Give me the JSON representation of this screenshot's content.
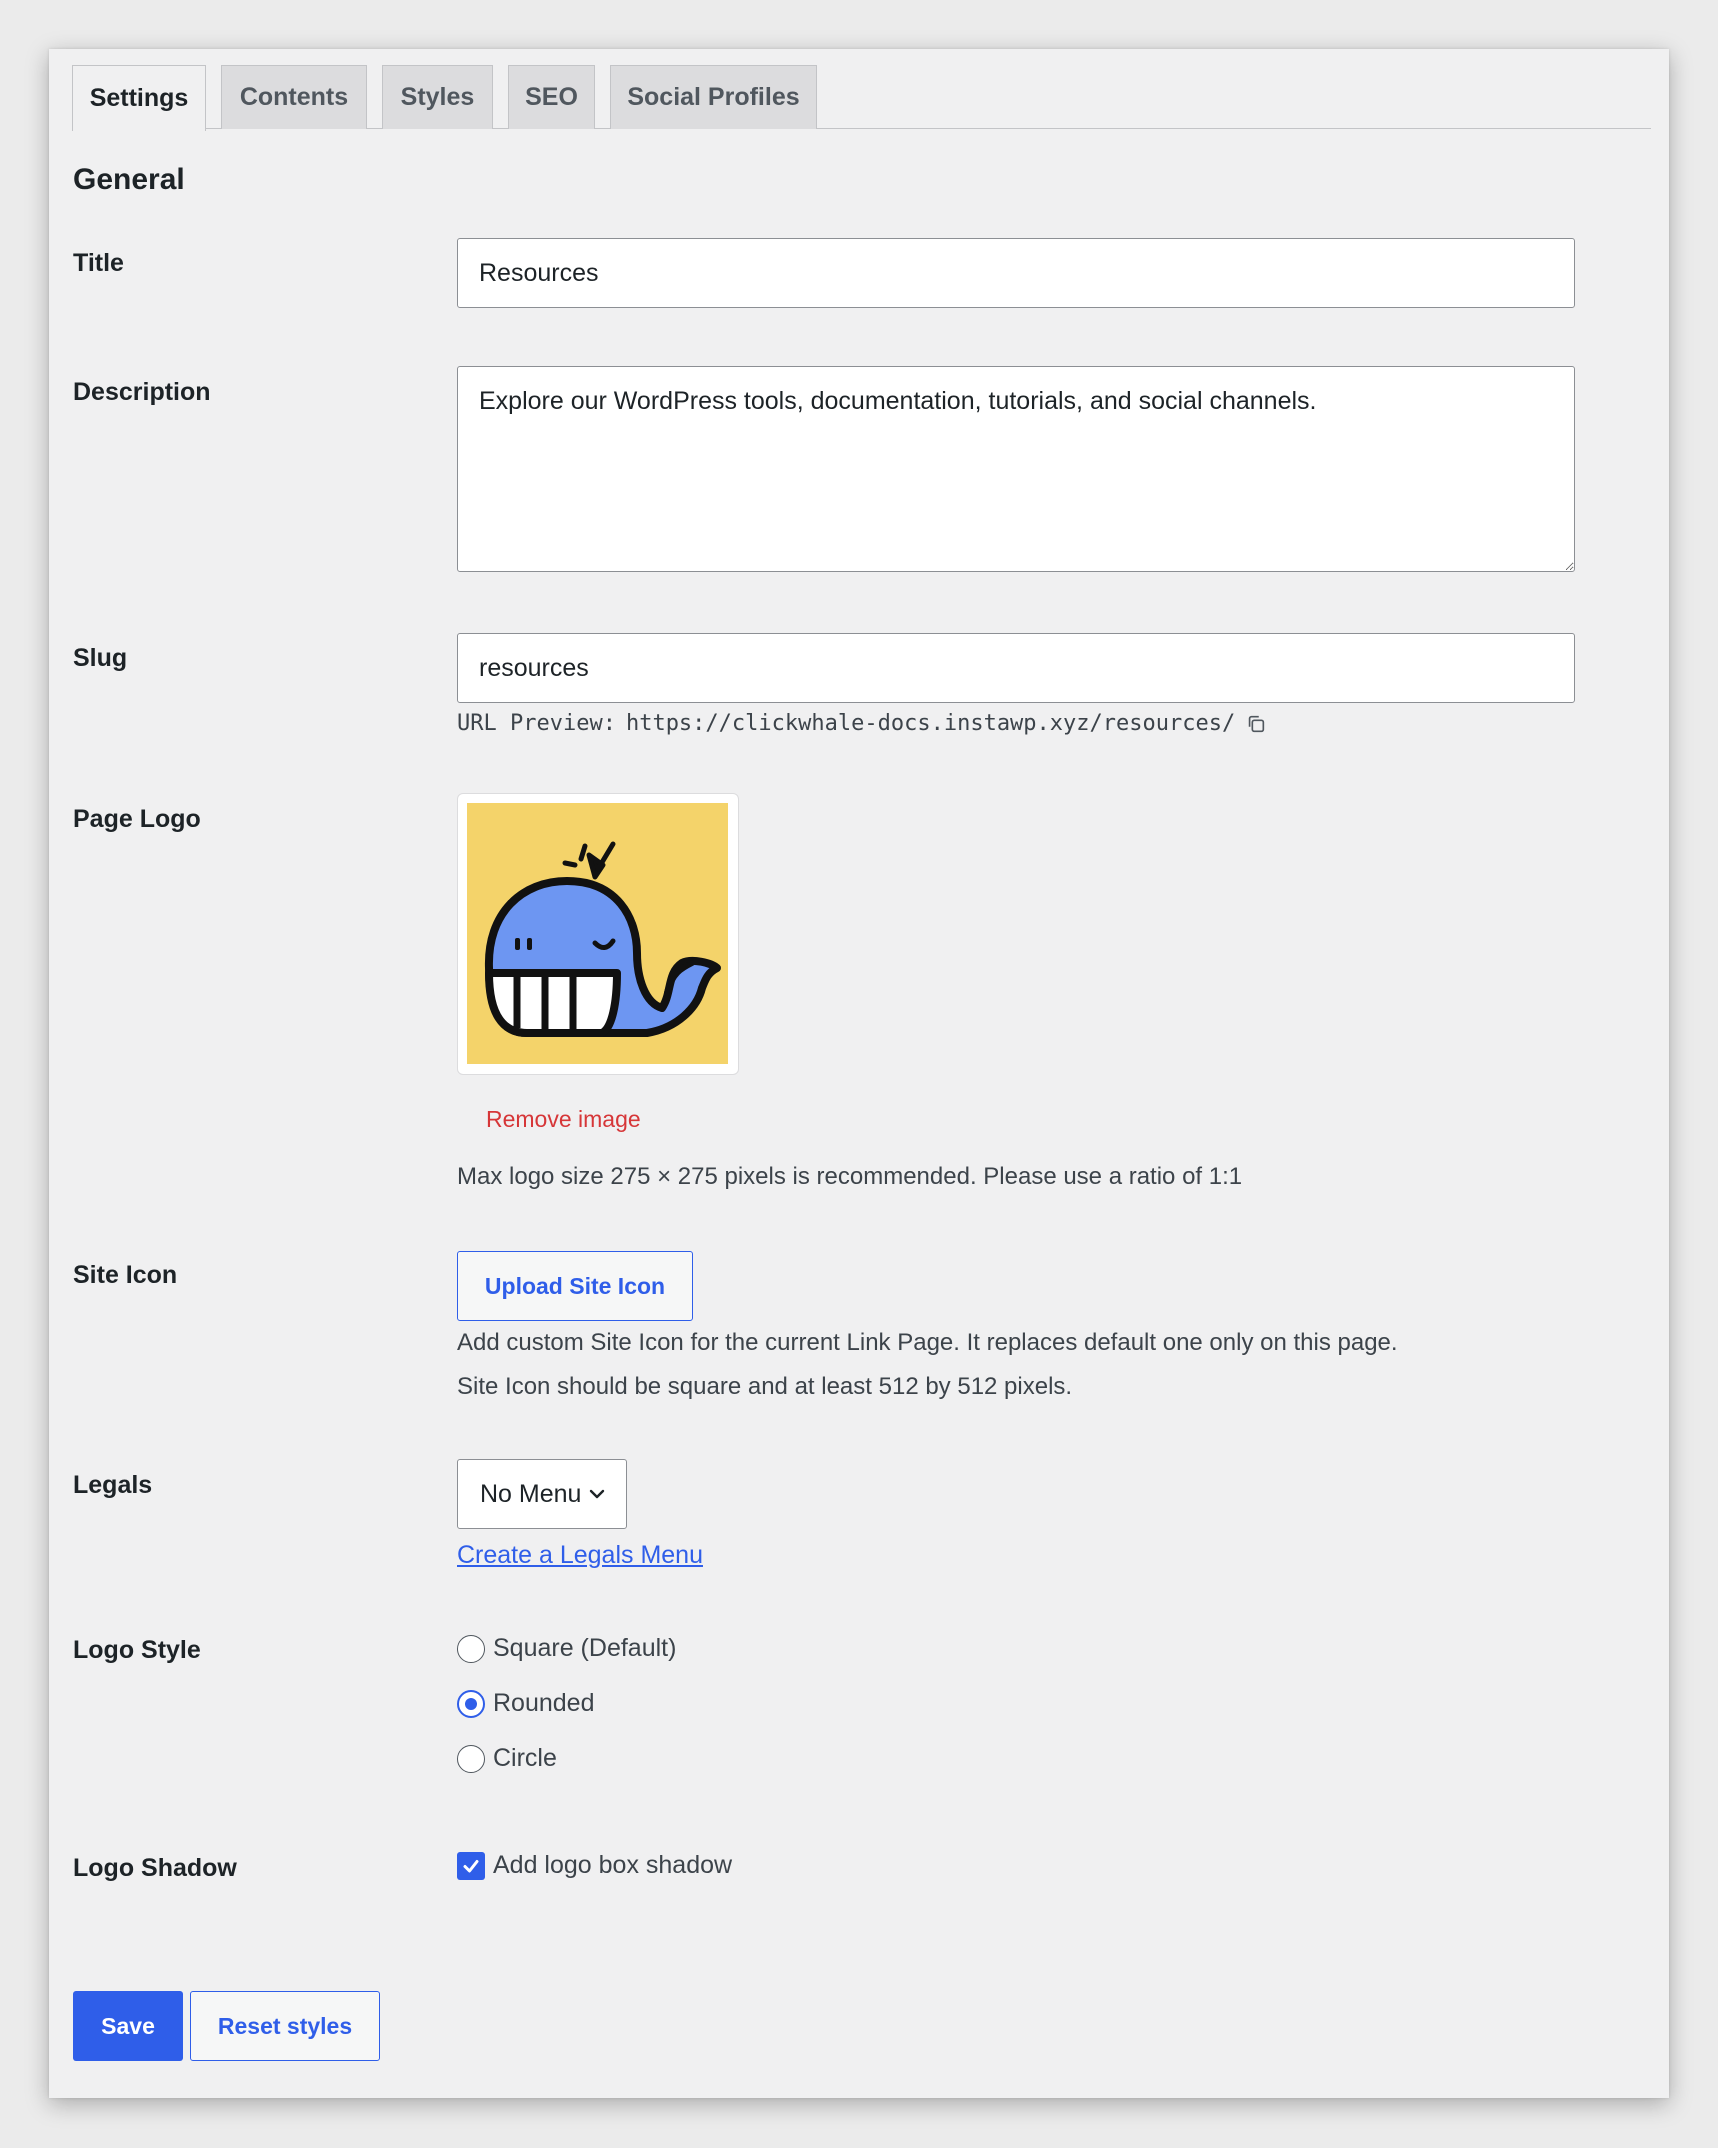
{
  "tabs": [
    {
      "label": "Settings",
      "active": true
    },
    {
      "label": "Contents",
      "active": false
    },
    {
      "label": "Styles",
      "active": false
    },
    {
      "label": "SEO",
      "active": false
    },
    {
      "label": "Social Profiles",
      "active": false
    }
  ],
  "general": {
    "heading": "General",
    "title": {
      "label": "Title",
      "value": "Resources"
    },
    "description": {
      "label": "Description",
      "value": "Explore our WordPress tools, documentation, tutorials, and social channels."
    },
    "slug": {
      "label": "Slug",
      "value": "resources",
      "url_preview_label": "URL Preview:",
      "url_preview": "https://clickwhale-docs.instawp.xyz/resources/"
    },
    "page_logo": {
      "label": "Page Logo",
      "remove_label": "Remove image",
      "help": "Max logo size 275 × 275 pixels is recommended. Please use a ratio of 1:1",
      "logo_background": "#f4d36a"
    },
    "site_icon": {
      "label": "Site Icon",
      "button_label": "Upload Site Icon",
      "help_line1": "Add custom Site Icon for the current Link Page. It replaces default one only on this page.",
      "help_line2": "Site Icon should be square and at least 512 by 512 pixels."
    },
    "legals": {
      "label": "Legals",
      "selected": "No Menu",
      "link_label": "Create a Legals Menu"
    },
    "logo_style": {
      "label": "Logo Style",
      "options": [
        {
          "label": "Square (Default)",
          "checked": false
        },
        {
          "label": "Rounded",
          "checked": true
        },
        {
          "label": "Circle",
          "checked": false
        }
      ]
    },
    "logo_shadow": {
      "label": "Logo Shadow",
      "checkbox_label": "Add logo box shadow",
      "checked": true
    }
  },
  "actions": {
    "save_label": "Save",
    "reset_label": "Reset styles"
  },
  "colors": {
    "accent": "#2f5ee9",
    "danger": "#d63638"
  }
}
